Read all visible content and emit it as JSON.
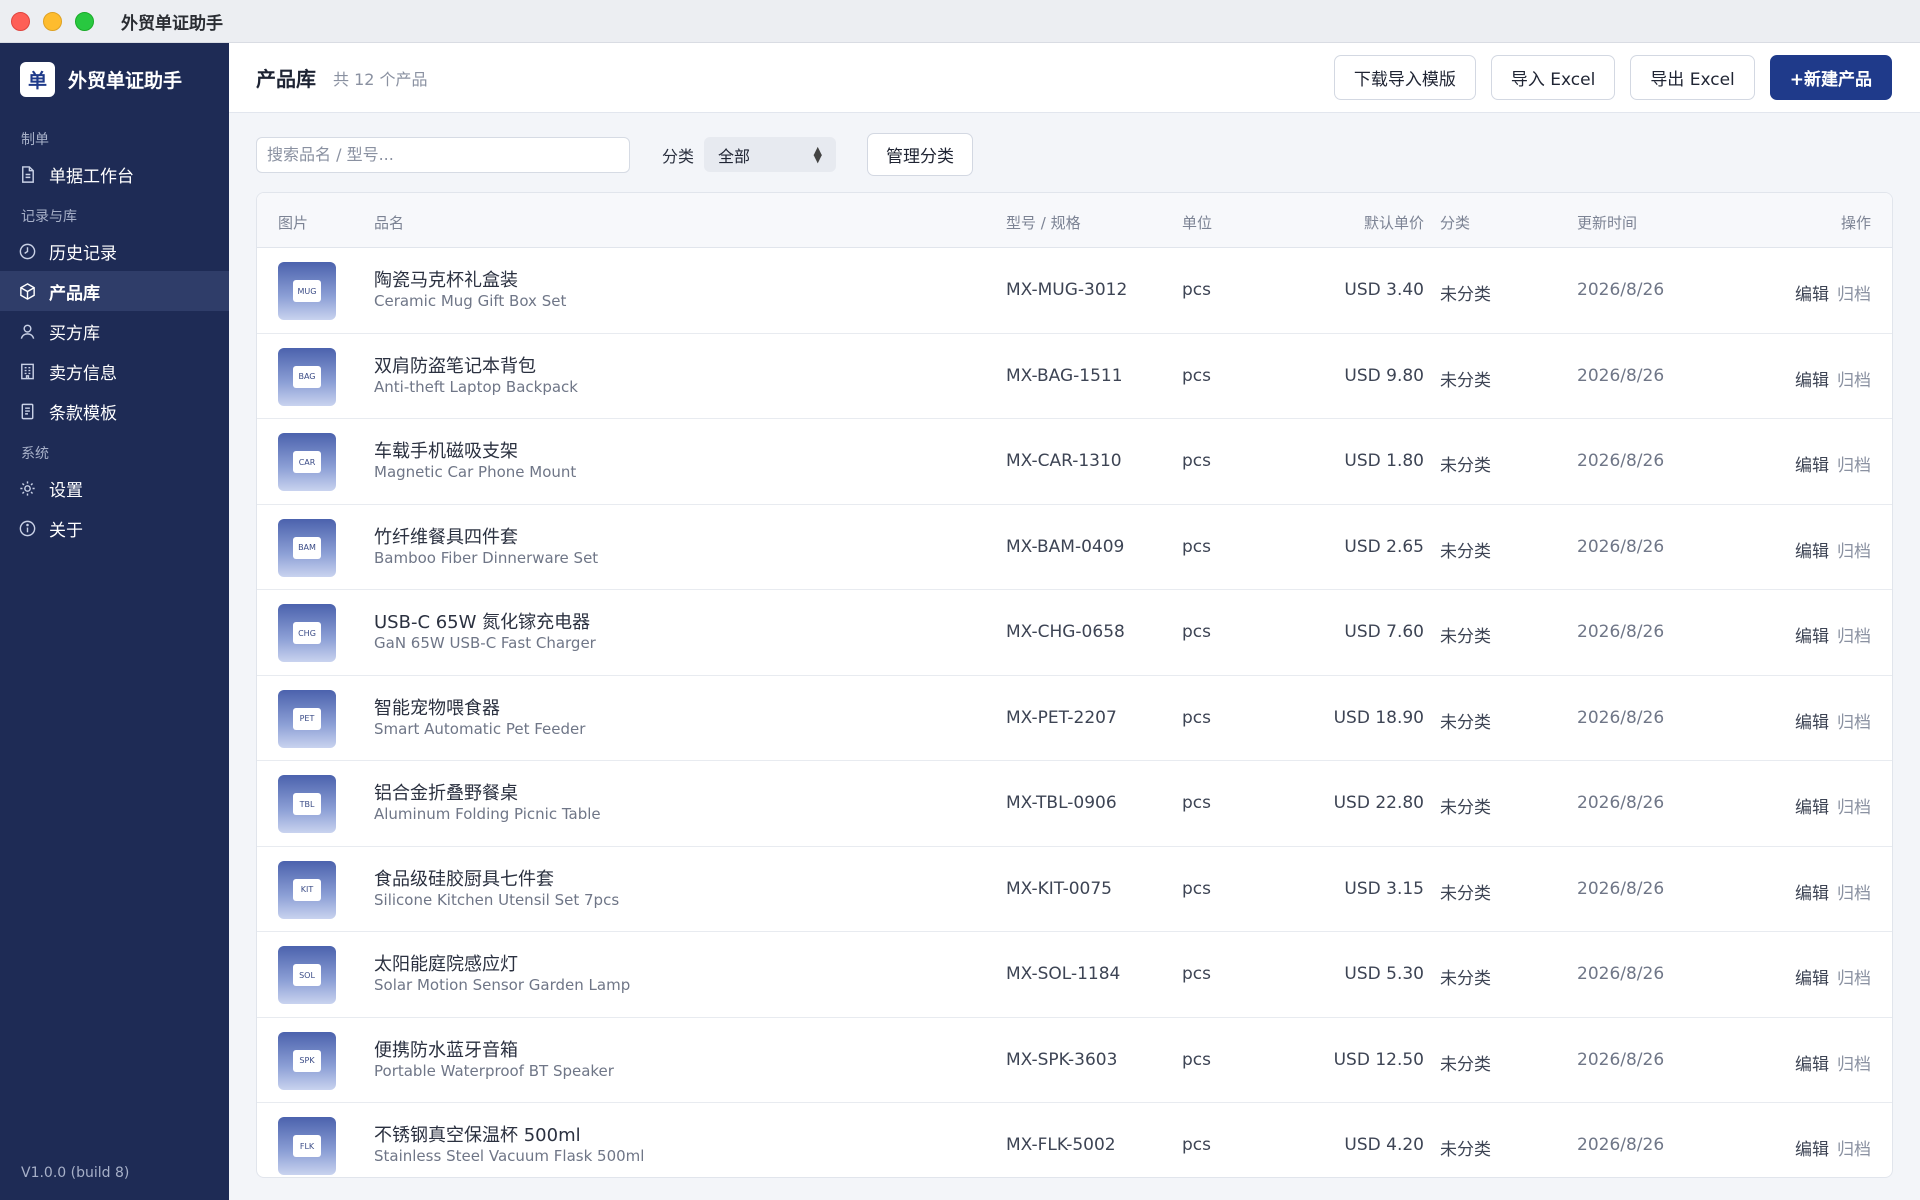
{
  "window": {
    "title": "外贸单证助手"
  },
  "sidebar": {
    "brand_logo": "单",
    "brand_name": "外贸单证助手",
    "sections": {
      "make": "制单",
      "records": "记录与库",
      "system": "系统"
    },
    "items": {
      "workbench": "单据工作台",
      "history": "历史记录",
      "products": "产品库",
      "buyers": "买方库",
      "seller": "卖方信息",
      "terms": "条款模板",
      "settings": "设置",
      "about": "关于"
    },
    "version": "V1.0.0 (build 8)"
  },
  "header": {
    "title": "产品库",
    "count": "共 12 个产品",
    "buttons": {
      "download_template": "下载导入模版",
      "import": "导入 Excel",
      "export": "导出 Excel",
      "new": "+新建产品"
    }
  },
  "toolbar": {
    "search_placeholder": "搜索品名 / 型号...",
    "filter_label": "分类",
    "filter_value": "全部",
    "manage_label": "管理分类"
  },
  "table": {
    "headers": {
      "image": "图片",
      "name": "品名",
      "model": "型号 / 规格",
      "unit": "单位",
      "price": "默认单价",
      "category": "分类",
      "updated": "更新时间",
      "ops": "操作"
    },
    "edit_label": "编辑",
    "archive_label": "归档",
    "rows": [
      {
        "thumb": "MUG",
        "name_zh": "陶瓷马克杯礼盒装",
        "name_en": "Ceramic Mug Gift Box Set",
        "model": "MX-MUG-3012",
        "unit": "pcs",
        "price": "USD 3.40",
        "category": "未分类",
        "updated": "2026/8/26"
      },
      {
        "thumb": "BAG",
        "name_zh": "双肩防盗笔记本背包",
        "name_en": "Anti-theft Laptop Backpack",
        "model": "MX-BAG-1511",
        "unit": "pcs",
        "price": "USD 9.80",
        "category": "未分类",
        "updated": "2026/8/26"
      },
      {
        "thumb": "CAR",
        "name_zh": "车载手机磁吸支架",
        "name_en": "Magnetic Car Phone Mount",
        "model": "MX-CAR-1310",
        "unit": "pcs",
        "price": "USD 1.80",
        "category": "未分类",
        "updated": "2026/8/26"
      },
      {
        "thumb": "BAM",
        "name_zh": "竹纤维餐具四件套",
        "name_en": "Bamboo Fiber Dinnerware Set",
        "model": "MX-BAM-0409",
        "unit": "pcs",
        "price": "USD 2.65",
        "category": "未分类",
        "updated": "2026/8/26"
      },
      {
        "thumb": "CHG",
        "name_zh": "USB-C 65W 氮化镓充电器",
        "name_en": "GaN 65W USB-C Fast Charger",
        "model": "MX-CHG-0658",
        "unit": "pcs",
        "price": "USD 7.60",
        "category": "未分类",
        "updated": "2026/8/26"
      },
      {
        "thumb": "PET",
        "name_zh": "智能宠物喂食器",
        "name_en": "Smart Automatic Pet Feeder",
        "model": "MX-PET-2207",
        "unit": "pcs",
        "price": "USD 18.90",
        "category": "未分类",
        "updated": "2026/8/26"
      },
      {
        "thumb": "TBL",
        "name_zh": "铝合金折叠野餐桌",
        "name_en": "Aluminum Folding Picnic Table",
        "model": "MX-TBL-0906",
        "unit": "pcs",
        "price": "USD 22.80",
        "category": "未分类",
        "updated": "2026/8/26"
      },
      {
        "thumb": "KIT",
        "name_zh": "食品级硅胶厨具七件套",
        "name_en": "Silicone Kitchen Utensil Set 7pcs",
        "model": "MX-KIT-0075",
        "unit": "pcs",
        "price": "USD 3.15",
        "category": "未分类",
        "updated": "2026/8/26"
      },
      {
        "thumb": "SOL",
        "name_zh": "太阳能庭院感应灯",
        "name_en": "Solar Motion Sensor Garden Lamp",
        "model": "MX-SOL-1184",
        "unit": "pcs",
        "price": "USD 5.30",
        "category": "未分类",
        "updated": "2026/8/26"
      },
      {
        "thumb": "SPK",
        "name_zh": "便携防水蓝牙音箱",
        "name_en": "Portable Waterproof BT Speaker",
        "model": "MX-SPK-3603",
        "unit": "pcs",
        "price": "USD 12.50",
        "category": "未分类",
        "updated": "2026/8/26"
      },
      {
        "thumb": "FLK",
        "name_zh": "不锈钢真空保温杯 500ml",
        "name_en": "Stainless Steel Vacuum Flask 500ml",
        "model": "MX-FLK-5002",
        "unit": "pcs",
        "price": "USD 4.20",
        "category": "未分类",
        "updated": "2026/8/26"
      }
    ]
  }
}
